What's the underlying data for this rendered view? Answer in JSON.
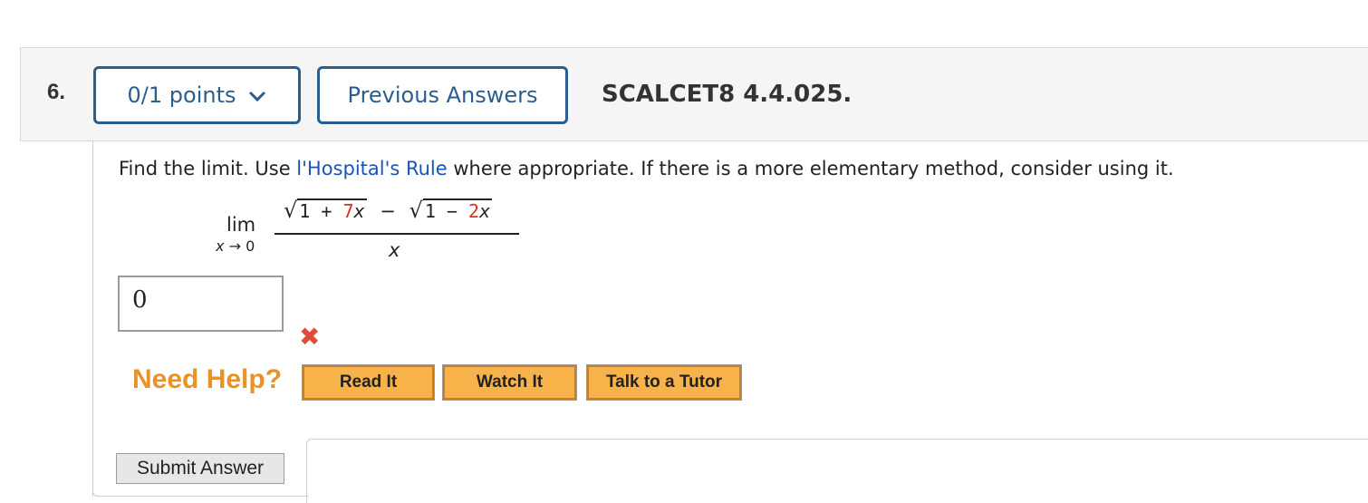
{
  "question": {
    "number": "6.",
    "points_label": "0/1 points",
    "previous_answers_label": "Previous Answers",
    "id": "SCALCET8 4.4.025."
  },
  "prompt": {
    "before_link": "Find the limit. Use ",
    "link": "l'Hospital's Rule",
    "after_link": " where appropriate. If there is a more elementary method, consider using it."
  },
  "math": {
    "lim": "lim",
    "sub_var": "x",
    "sub_arrow": "→",
    "sub_value": "0",
    "rad1_prefix": "1 + ",
    "rad1_red": "7",
    "rad1_var": "x",
    "minus": "−",
    "rad2_prefix": "1 − ",
    "rad2_red": "2",
    "rad2_var": "x",
    "denominator": "x"
  },
  "answer": {
    "value": "0",
    "status_icon": "incorrect-x-icon"
  },
  "help": {
    "label": "Need Help?",
    "read_it": "Read It",
    "watch_it": "Watch It",
    "talk_to_tutor": "Talk to a Tutor"
  },
  "submit_label": "Submit Answer",
  "colors": {
    "pill_border": "#2c5d8f",
    "link": "#1a55b5",
    "highlight_red": "#d9301e",
    "need_help_orange": "#e8922a",
    "help_button": "#f7b24a",
    "wrong_mark": "#e24a3c"
  }
}
